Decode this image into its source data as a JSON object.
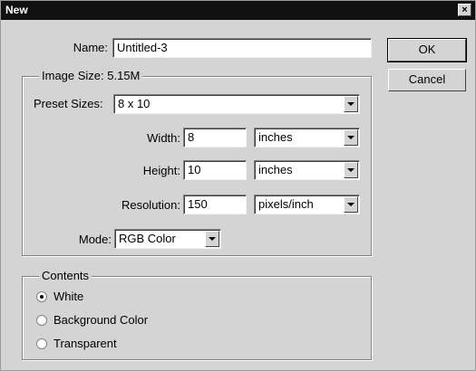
{
  "window": {
    "title": "New",
    "close_label": "×"
  },
  "name_field": {
    "label": "Name:",
    "value": "Untitled-3"
  },
  "buttons": {
    "ok": "OK",
    "cancel": "Cancel"
  },
  "image_size": {
    "legend": "Image Size: 5.15M",
    "preset": {
      "label": "Preset Sizes:",
      "value": "8 x 10"
    },
    "width": {
      "label": "Width:",
      "value": "8",
      "unit": "inches"
    },
    "height": {
      "label": "Height:",
      "value": "10",
      "unit": "inches"
    },
    "resolution": {
      "label": "Resolution:",
      "value": "150",
      "unit": "pixels/inch"
    },
    "mode": {
      "label": "Mode:",
      "value": "RGB Color"
    }
  },
  "contents": {
    "legend": "Contents",
    "options": [
      {
        "label": "White",
        "selected": true
      },
      {
        "label": "Background Color",
        "selected": false
      },
      {
        "label": "Transparent",
        "selected": false
      }
    ]
  }
}
